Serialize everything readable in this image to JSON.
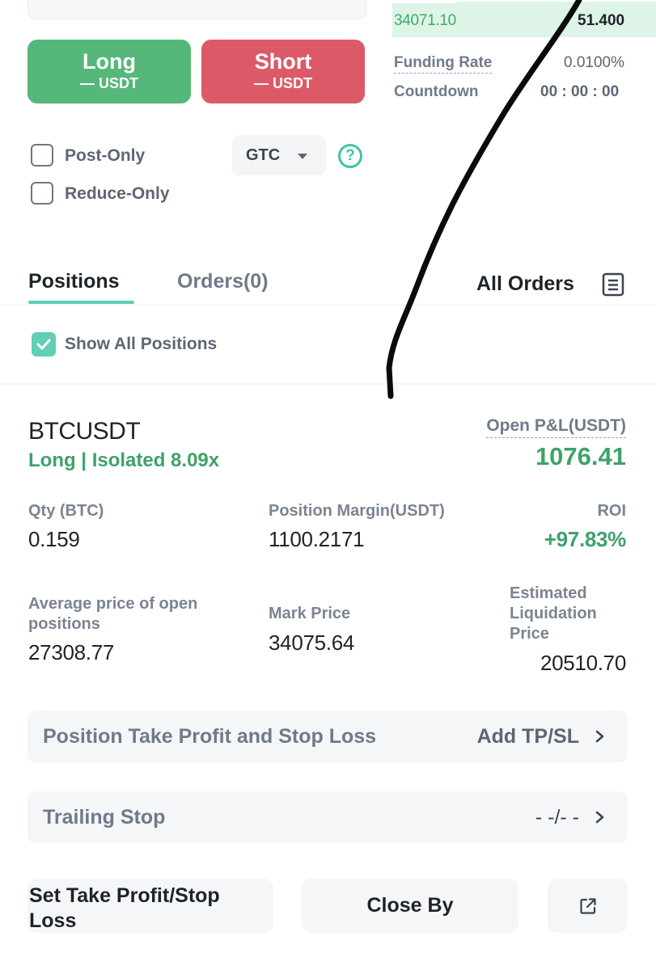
{
  "order_book": {
    "price": "34071.10",
    "quantity": "51.400",
    "funding_rate_label": "Funding Rate",
    "funding_rate_value": "0.0100%",
    "countdown_label": "Countdown",
    "countdown_value": "00 : 00 : 00"
  },
  "trade": {
    "long_label": "Long",
    "long_sub": "— USDT",
    "short_label": "Short",
    "short_sub": "— USDT",
    "post_only_label": "Post-Only",
    "reduce_only_label": "Reduce-Only",
    "time_in_force": "GTC",
    "help_glyph": "?"
  },
  "tabs": {
    "positions": "Positions",
    "orders": "Orders(0)",
    "all_orders": "All Orders"
  },
  "show_all_positions_label": "Show All Positions",
  "position": {
    "symbol": "BTCUSDT",
    "description": "Long | Isolated 8.09x",
    "open_pnl_label": "Open P&L(USDT)",
    "open_pnl_value": "1076.41",
    "qty_label": "Qty (BTC)",
    "qty_value": "0.159",
    "margin_label": "Position Margin(USDT)",
    "margin_value": "1100.2171",
    "roi_label": "ROI",
    "roi_value": "+97.83%",
    "avg_price_label": "Average price of open positions",
    "avg_price_value": "27308.77",
    "mark_price_label": "Mark Price",
    "mark_price_value": "34075.64",
    "liq_price_label": "Estimated Liquidation Price",
    "liq_price_value": "20510.70",
    "tpsl_label": "Position Take Profit and Stop Loss",
    "tpsl_action": "Add TP/SL",
    "trailing_label": "Trailing Stop",
    "trailing_value": "- -/- -",
    "set_tpsl_button": "Set Take Profit/Stop Loss",
    "close_by_button": "Close By"
  },
  "colors": {
    "long_green": "#56b77a",
    "short_red": "#dc5a68",
    "accent_teal": "#5bd0b6",
    "profit_green": "#3ea26a"
  },
  "icons": {
    "order_list": "document-list-icon",
    "share": "external-link-icon",
    "chevron": "chevron-right-icon",
    "dropdown": "caret-down-icon"
  }
}
